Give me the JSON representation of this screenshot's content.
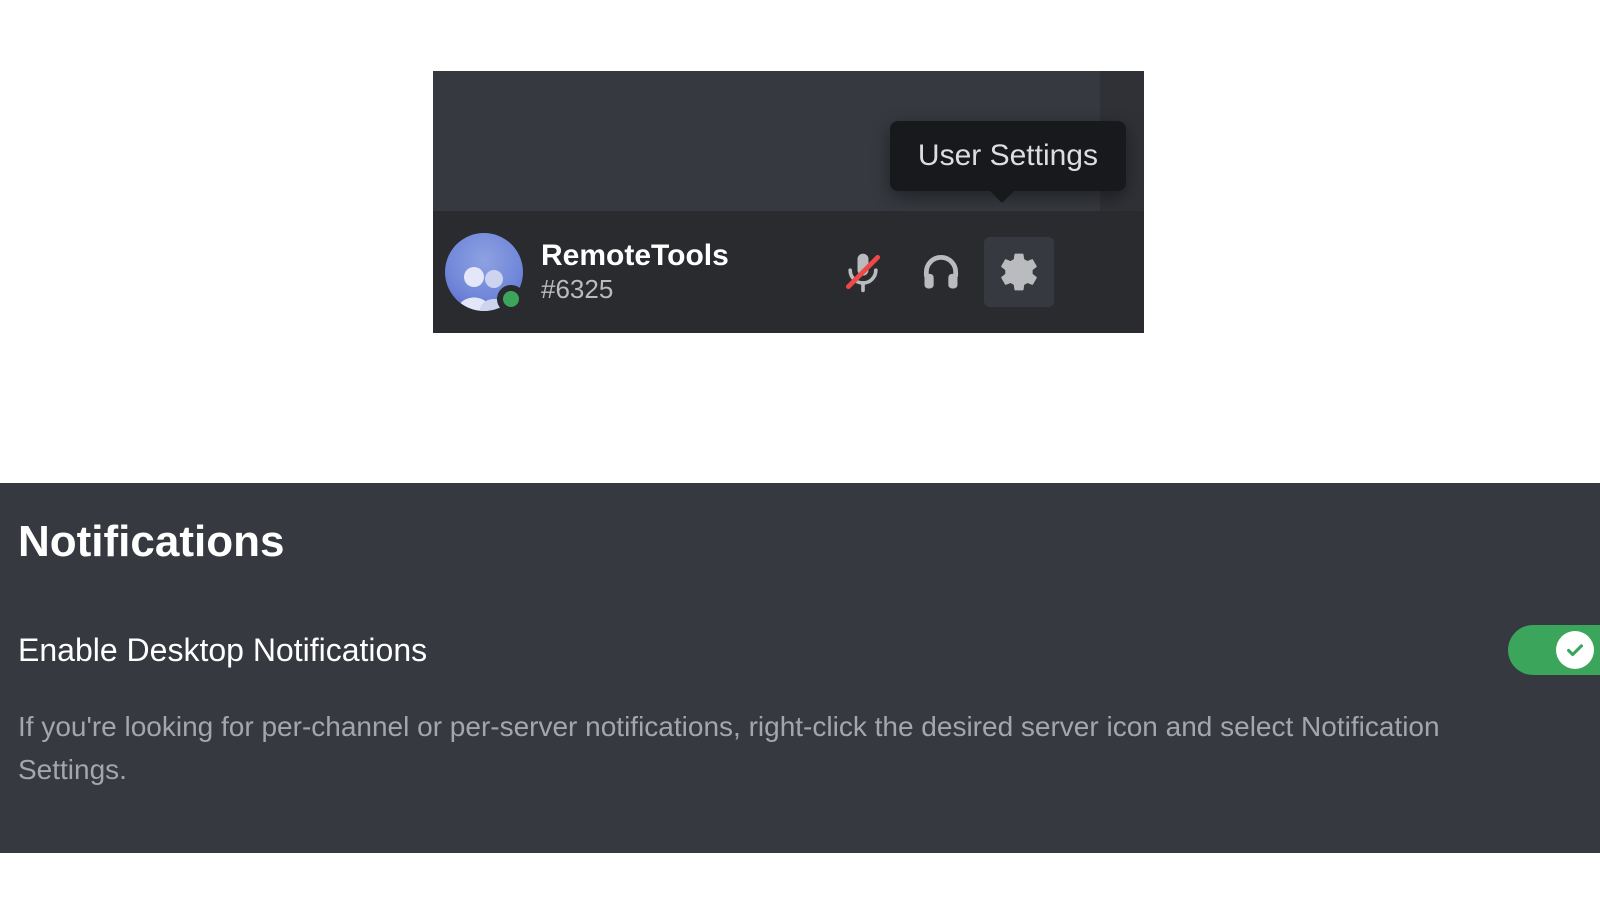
{
  "userPanel": {
    "username": "RemoteTools",
    "discriminator": "#6325",
    "tooltip": "User Settings"
  },
  "settings": {
    "title": "Notifications",
    "option": {
      "label": "Enable Desktop Notifications",
      "description": "If you're looking for per-channel or per-server notifications, right-click the desired server icon and select Notification Settings.",
      "enabled": true
    }
  },
  "colors": {
    "bgDark": "#36393f",
    "bgDarker": "#292b2f",
    "tooltipBg": "#18191c",
    "accentGreen": "#3ba55c",
    "textMuted": "#a3a6aa"
  }
}
